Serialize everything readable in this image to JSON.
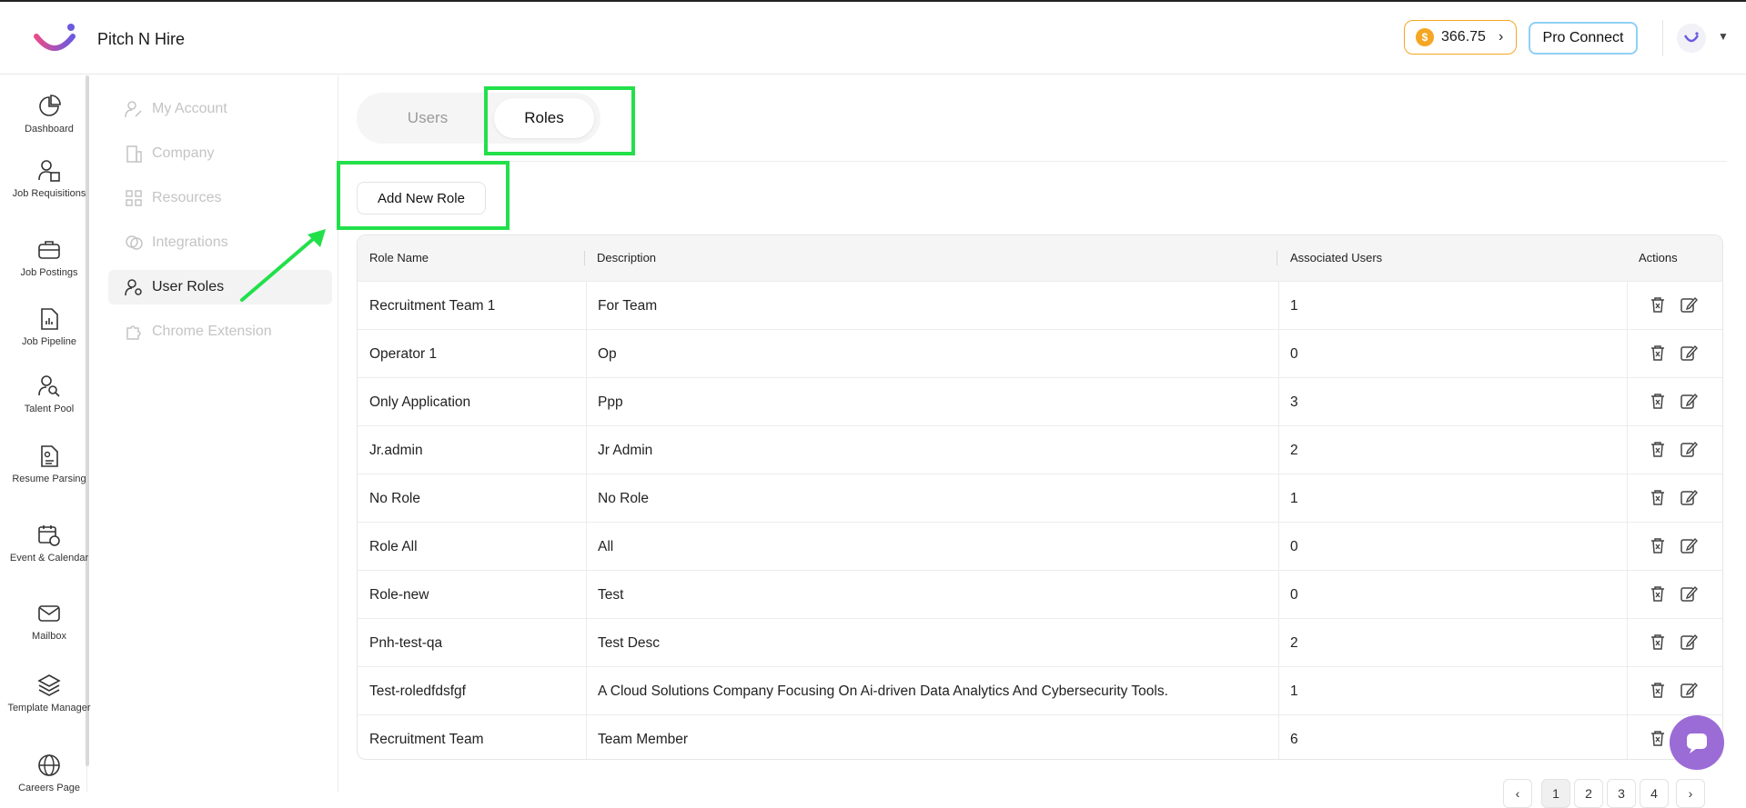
{
  "header": {
    "brand": "Pitch N Hire",
    "credits": "366.75",
    "pro_connect": "Pro Connect"
  },
  "rail": [
    {
      "label": "Dashboard",
      "icon": "dashboard-icon"
    },
    {
      "label": "Job Requisitions",
      "icon": "job-requisitions-icon"
    },
    {
      "label": "Job Postings",
      "icon": "briefcase-icon"
    },
    {
      "label": "Job Pipeline",
      "icon": "pipeline-icon"
    },
    {
      "label": "Talent Pool",
      "icon": "talent-search-icon"
    },
    {
      "label": "Resume Parsing",
      "icon": "resume-icon"
    },
    {
      "label": "Event & Calendar",
      "icon": "calendar-icon"
    },
    {
      "label": "Mailbox",
      "icon": "mail-icon"
    },
    {
      "label": "Template Manager",
      "icon": "layers-icon"
    },
    {
      "label": "Careers Page",
      "icon": "globe-icon"
    }
  ],
  "settings_nav": [
    {
      "label": "My Account",
      "icon": "user-edit-icon"
    },
    {
      "label": "Company",
      "icon": "building-icon"
    },
    {
      "label": "Resources",
      "icon": "grid-icon"
    },
    {
      "label": "Integrations",
      "icon": "integrations-icon"
    },
    {
      "label": "User Roles",
      "icon": "user-settings-icon",
      "active": true
    },
    {
      "label": "Chrome Extension",
      "icon": "puzzle-icon"
    }
  ],
  "tabs": {
    "users": "Users",
    "roles": "Roles",
    "active": "Roles"
  },
  "add_role_label": "Add New Role",
  "table": {
    "columns": [
      "Role Name",
      "Description",
      "Associated Users",
      "Actions"
    ],
    "rows": [
      {
        "name": "Recruitment Team 1",
        "description": "For Team",
        "users": "1"
      },
      {
        "name": "Operator 1",
        "description": "Op",
        "users": "0"
      },
      {
        "name": "Only Application",
        "description": "Ppp",
        "users": "3"
      },
      {
        "name": "Jr.admin",
        "description": "Jr Admin",
        "users": "2"
      },
      {
        "name": "No Role",
        "description": "No Role",
        "users": "1"
      },
      {
        "name": "Role All",
        "description": "All",
        "users": "0"
      },
      {
        "name": "Role-new",
        "description": "Test",
        "users": "0"
      },
      {
        "name": "Pnh-test-qa",
        "description": "Test Desc",
        "users": "2"
      },
      {
        "name": "Test-roledfdsfgf",
        "description": "A Cloud Solutions Company Focusing On Ai-driven Data Analytics And Cybersecurity Tools.",
        "users": "1"
      },
      {
        "name": "Recruitment Team",
        "description": "Team Member",
        "users": "6"
      }
    ]
  },
  "pagination": {
    "prev": "‹",
    "pages": [
      "1",
      "2",
      "3",
      "4"
    ],
    "current": "1",
    "next": "›"
  },
  "colors": {
    "highlight": "#22e04a",
    "accent": "#9b6bd6",
    "coin": "#f5a623"
  }
}
